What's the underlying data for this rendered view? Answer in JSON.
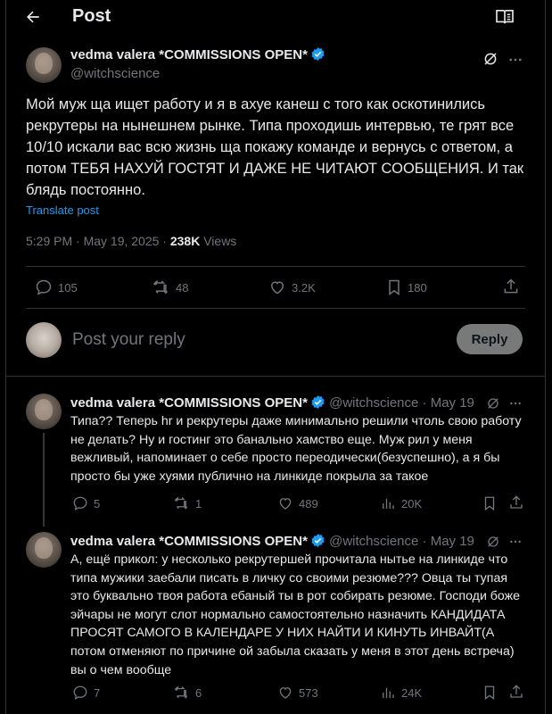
{
  "header": {
    "title": "Post"
  },
  "main_post": {
    "name": "vedma valera *COMMISSIONS OPEN*",
    "handle": "@witchscience",
    "text": "Мой муж ща ищет работу и я в ахуе канеш с того как оскотинились рекрутеры на нынешнем рынке. Типа проходишь интервью, те грят все 10/10 искали вас всю жизнь ща покажу команде и вернусь с ответом, а потом ТЕБЯ НАХУЙ ГОСТЯТ И ДАЖЕ НЕ ЧИТАЮТ СООБЩЕНИЯ. И так блядь постоянно.",
    "translate": "Translate post",
    "time": "5:29 PM · May 19, 2025 · ",
    "views": "238K",
    "views_label": " Views",
    "replies": "105",
    "reposts": "48",
    "likes": "3.2K",
    "bookmarks": "180"
  },
  "composer": {
    "placeholder": "Post your reply",
    "button": "Reply"
  },
  "replies": [
    {
      "name": "vedma valera *COMMISSIONS OPEN*",
      "handle": "@witchscience",
      "date": " · May 19",
      "text": "Типа?? Теперь hr и рекрутеры даже минимально решили чтоль свою работу не делать? Ну и гостинг это банально хамство еще. Муж рил у меня вежливый, напоминает о себе просто переодически(безуспешно), а я бы просто бы уже хуями публично на линкиде покрыла за такое",
      "replies": "5",
      "reposts": "1",
      "likes": "489",
      "views": "20K"
    },
    {
      "name": "vedma valera *COMMISSIONS OPEN*",
      "handle": "@witchscience",
      "date": " · May 19",
      "text": "А, ещё прикол: у несколько рекрутершей прочитала нытье на линкиде что типа мужики заебали писать в личку со своими резюме??? Овца ты тупая это буквально твоя работа ебаный ты в рот собирать резюме. Господи боже эйчары не могут слот нормально самостоятельно назначить КАНДИДАТА ПРОСЯТ САМОГО В КАЛЕНДАРЕ У НИХ НАЙТИ И КИНУТЬ ИНВАЙТ(А потом отменяют по причине ой забыла сказать у меня в этот день встреча) вы о чем вообще",
      "replies": "7",
      "reposts": "6",
      "likes": "573",
      "views": "24K"
    }
  ]
}
